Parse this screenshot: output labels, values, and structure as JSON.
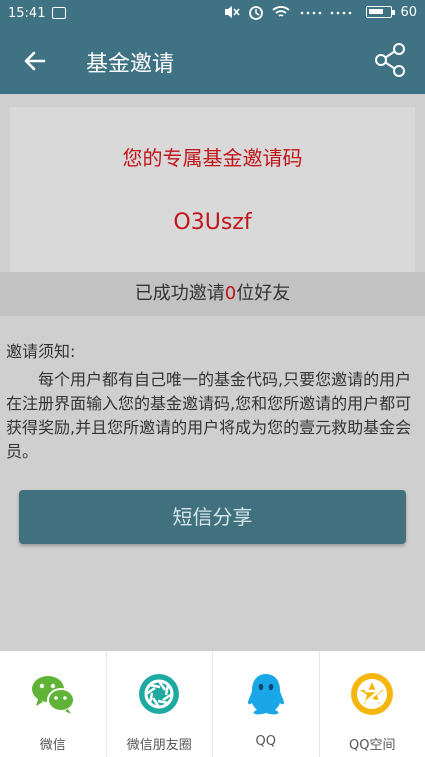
{
  "status_bar": {
    "time": "15:41",
    "battery": "60"
  },
  "toolbar": {
    "title": "基金邀请"
  },
  "invite_code": {
    "title": "您的专属基金邀请码",
    "code": "O3Uszf"
  },
  "invite_count": {
    "prefix": "已成功邀请",
    "count": "0",
    "suffix": "位好友"
  },
  "notice": {
    "title": "邀请须知:",
    "body": "每个用户都有自己唯一的基金代码,只要您邀请的用户在注册界面输入您的基金邀请码,您和您所邀请的用户都可获得奖励,并且您所邀请的用户将成为您的壹元救助基金会员。"
  },
  "sms_button": {
    "label": "短信分享"
  },
  "share_targets": [
    {
      "label": "微信",
      "icon": "wechat-icon",
      "color": "#5fb336"
    },
    {
      "label": "微信朋友圈",
      "icon": "moments-icon",
      "color": "#1eaaa0"
    },
    {
      "label": "QQ",
      "icon": "qq-icon",
      "color": "#1aa7e8"
    },
    {
      "label": "QQ空间",
      "icon": "qzone-icon",
      "color": "#f5b70f"
    }
  ]
}
